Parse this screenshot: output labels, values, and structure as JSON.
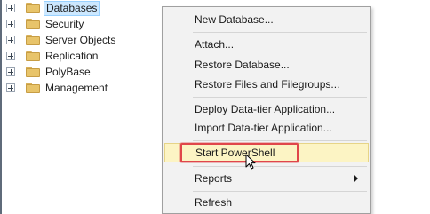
{
  "object_explorer": {
    "items": [
      {
        "label": "Databases",
        "selected": true
      },
      {
        "label": "Security",
        "selected": false
      },
      {
        "label": "Server Objects",
        "selected": false
      },
      {
        "label": "Replication",
        "selected": false
      },
      {
        "label": "PolyBase",
        "selected": false
      },
      {
        "label": "Management",
        "selected": false
      }
    ]
  },
  "context_menu": {
    "new_database": "New Database...",
    "attach": "Attach...",
    "restore_database": "Restore Database...",
    "restore_files": "Restore Files and Filegroups...",
    "deploy_data_tier": "Deploy Data-tier Application...",
    "import_data_tier": "Import Data-tier Application...",
    "start_powershell": "Start PowerShell",
    "reports": "Reports",
    "refresh": "Refresh"
  },
  "colors": {
    "highlight_bg": "#fcf4c4",
    "callout_border": "#e0464a",
    "selection_bg": "#cce8ff",
    "folder": "#e8c46a"
  }
}
